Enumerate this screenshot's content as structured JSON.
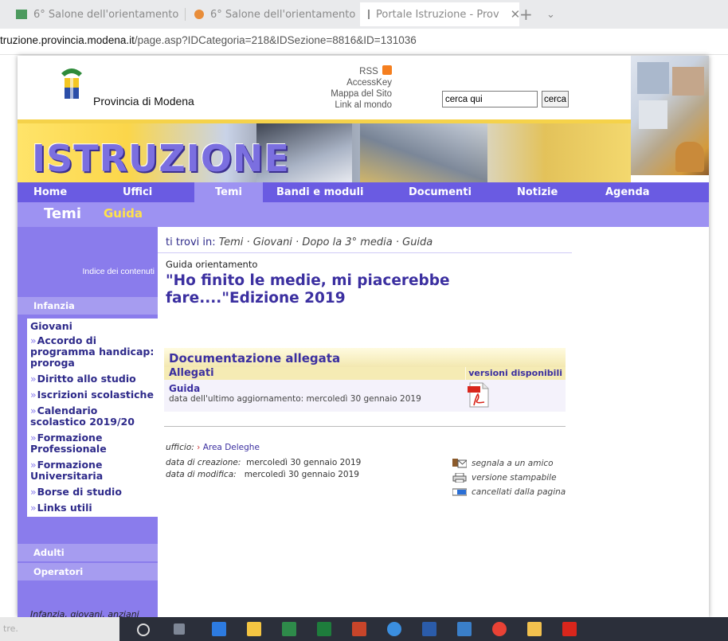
{
  "browser": {
    "tabs": [
      {
        "label": "6° Salone dell'orientamento"
      },
      {
        "label": "6° Salone dell'orientamento"
      },
      {
        "label": "Portale Istruzione - Prov"
      }
    ],
    "url_host": "truzione.provincia.modena.it",
    "url_path": "/page.asp?IDCategoria=218&IDSezione=8816&ID=131036"
  },
  "header": {
    "org_name": "Provincia di Modena",
    "links": [
      "RSS",
      "AccessKey",
      "Mappa del Sito",
      "Link al mondo"
    ],
    "search_value": "cerca qui",
    "search_button": "cerca",
    "banner_title": "ISTRUZIONE"
  },
  "nav": {
    "items": [
      "Home",
      "Uffici",
      "Temi",
      "Bandi e moduli",
      "Documenti",
      "Notizie",
      "Agenda"
    ],
    "active": "Temi"
  },
  "subbar": {
    "section": "Temi",
    "subsection": "Guida"
  },
  "sidebar": {
    "index_label": "Indice dei contenuti",
    "headers": [
      "Infanzia",
      "Adulti",
      "Operatori"
    ],
    "current_group": "Giovani",
    "items": [
      "Accordo di programma handicap: proroga",
      "Diritto allo studio",
      "Iscrizioni scolastiche",
      "Calendario scolastico 2019/20",
      "Formazione Professionale",
      "Formazione Universitaria",
      "Borse di studio",
      "Links utili"
    ],
    "footer_text": "Infanzia, giovani, anziani"
  },
  "breadcrumb": {
    "label": "ti trovi in:",
    "path": "Temi · Giovani · Dopo la 3° media · Guida"
  },
  "article": {
    "kicker": "Guida orientamento",
    "title": "\"Ho finito le medie, mi piacerebbe fare....\"Edizione 2019"
  },
  "attachments": {
    "title": "Documentazione allegata",
    "header_left": "Allegati",
    "header_right": "versioni disponibili",
    "file_name": "Guida",
    "file_date": "data dell'ultimo aggiornamento: mercoledì 30 gennaio 2019"
  },
  "meta": {
    "office_label": "ufficio:",
    "office_value": "Area Deleghe",
    "created_label": "data di creazione:",
    "created_value": "mercoledì 30 gennaio 2019",
    "modified_label": "data di modifica:",
    "modified_value": "mercoledì 30 gennaio 2019"
  },
  "actions": [
    "segnala a un amico",
    "versione stampabile",
    "cancellati dalla pagina"
  ],
  "taskbar": {
    "left_text": "tre."
  },
  "colors": {
    "nav": "#6a5be2",
    "subbar": "#9d92f2",
    "sidebar": "#8a7cec",
    "link": "#3b2fa0",
    "accent_yellow": "#ffe24a"
  }
}
